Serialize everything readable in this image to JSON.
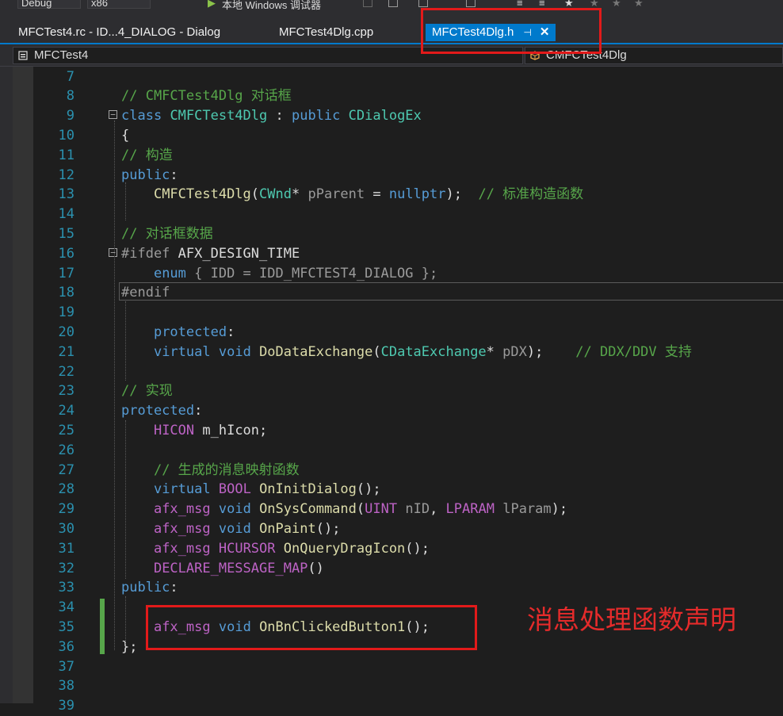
{
  "toolbar": {
    "config": "Debug",
    "platform": "x86",
    "run_label": "本地 Windows 调试器"
  },
  "tabs": [
    {
      "label": "MFCTest4.rc - ID...4_DIALOG - Dialog",
      "active": false
    },
    {
      "label": "MFCTest4Dlg.cpp",
      "active": false
    },
    {
      "label": "MFCTest4Dlg.h",
      "active": true
    }
  ],
  "navbar": {
    "project": "MFCTest4",
    "scope": "CMFCTest4Dlg"
  },
  "editor": {
    "line_numbers": [
      "7",
      "8",
      "9",
      "10",
      "11",
      "12",
      "13",
      "14",
      "15",
      "16",
      "17",
      "18",
      "19",
      "20",
      "21",
      "22",
      "23",
      "24",
      "25",
      "26",
      "27",
      "28",
      "29",
      "30",
      "31",
      "32",
      "33",
      "34",
      "35",
      "36",
      "37",
      "38",
      "39"
    ],
    "lines": [
      [],
      [
        {
          "t": "// CMFCTest4Dlg 对话框",
          "c": "cm"
        }
      ],
      [
        {
          "t": "class",
          "c": "kw"
        },
        {
          "t": " "
        },
        {
          "t": "CMFCTest4Dlg",
          "c": "ty"
        },
        {
          "t": " : "
        },
        {
          "t": "public",
          "c": "kw"
        },
        {
          "t": " "
        },
        {
          "t": "CDialogEx",
          "c": "ty"
        }
      ],
      [
        {
          "t": "{"
        }
      ],
      [
        {
          "t": "// 构造",
          "c": "cm"
        }
      ],
      [
        {
          "t": "public",
          "c": "kw"
        },
        {
          "t": ":"
        }
      ],
      [
        {
          "t": "    "
        },
        {
          "t": "CMFCTest4Dlg",
          "c": "fn"
        },
        {
          "t": "("
        },
        {
          "t": "CWnd",
          "c": "ty"
        },
        {
          "t": "* "
        },
        {
          "t": "pParent",
          "c": "prm"
        },
        {
          "t": " = "
        },
        {
          "t": "nullptr",
          "c": "kw"
        },
        {
          "t": ");  "
        },
        {
          "t": "// 标准构造函数",
          "c": "cm"
        }
      ],
      [],
      [
        {
          "t": "// 对话框数据",
          "c": "cm"
        }
      ],
      [
        {
          "t": "#ifdef",
          "c": "pp"
        },
        {
          "t": " AFX_DESIGN_TIME"
        }
      ],
      [
        {
          "t": "    "
        },
        {
          "t": "enum",
          "c": "kw"
        },
        {
          "t": " { IDD = IDD_MFCTEST4_DIALOG };",
          "c": "greybg"
        }
      ],
      [
        {
          "t": "#endif",
          "c": "pp"
        }
      ],
      [],
      [
        {
          "t": "    "
        },
        {
          "t": "protected",
          "c": "kw"
        },
        {
          "t": ":"
        }
      ],
      [
        {
          "t": "    "
        },
        {
          "t": "virtual",
          "c": "kw"
        },
        {
          "t": " "
        },
        {
          "t": "void",
          "c": "kw"
        },
        {
          "t": " "
        },
        {
          "t": "DoDataExchange",
          "c": "fn"
        },
        {
          "t": "("
        },
        {
          "t": "CDataExchange",
          "c": "ty"
        },
        {
          "t": "* "
        },
        {
          "t": "pDX",
          "c": "prm"
        },
        {
          "t": ");    "
        },
        {
          "t": "// DDX/DDV 支持",
          "c": "cm"
        }
      ],
      [],
      [
        {
          "t": "// 实现",
          "c": "cm"
        }
      ],
      [
        {
          "t": "protected",
          "c": "kw"
        },
        {
          "t": ":"
        }
      ],
      [
        {
          "t": "    "
        },
        {
          "t": "HICON",
          "c": "mac"
        },
        {
          "t": " m_hIcon;"
        }
      ],
      [],
      [
        {
          "t": "    "
        },
        {
          "t": "// 生成的消息映射函数",
          "c": "cm"
        }
      ],
      [
        {
          "t": "    "
        },
        {
          "t": "virtual",
          "c": "kw"
        },
        {
          "t": " "
        },
        {
          "t": "BOOL",
          "c": "mac"
        },
        {
          "t": " "
        },
        {
          "t": "OnInitDialog",
          "c": "fn"
        },
        {
          "t": "();"
        }
      ],
      [
        {
          "t": "    "
        },
        {
          "t": "afx_msg",
          "c": "mac"
        },
        {
          "t": " "
        },
        {
          "t": "void",
          "c": "kw"
        },
        {
          "t": " "
        },
        {
          "t": "OnSysCommand",
          "c": "fn"
        },
        {
          "t": "("
        },
        {
          "t": "UINT",
          "c": "mac"
        },
        {
          "t": " "
        },
        {
          "t": "nID",
          "c": "prm"
        },
        {
          "t": ", "
        },
        {
          "t": "LPARAM",
          "c": "mac"
        },
        {
          "t": " "
        },
        {
          "t": "lParam",
          "c": "prm"
        },
        {
          "t": ");"
        }
      ],
      [
        {
          "t": "    "
        },
        {
          "t": "afx_msg",
          "c": "mac"
        },
        {
          "t": " "
        },
        {
          "t": "void",
          "c": "kw"
        },
        {
          "t": " "
        },
        {
          "t": "OnPaint",
          "c": "fn"
        },
        {
          "t": "();"
        }
      ],
      [
        {
          "t": "    "
        },
        {
          "t": "afx_msg",
          "c": "mac"
        },
        {
          "t": " "
        },
        {
          "t": "HCURSOR",
          "c": "mac"
        },
        {
          "t": " "
        },
        {
          "t": "OnQueryDragIcon",
          "c": "fn"
        },
        {
          "t": "();"
        }
      ],
      [
        {
          "t": "    "
        },
        {
          "t": "DECLARE_MESSAGE_MAP",
          "c": "mac"
        },
        {
          "t": "()"
        }
      ],
      [
        {
          "t": "public",
          "c": "kw"
        },
        {
          "t": ":"
        }
      ],
      [],
      [
        {
          "t": "    "
        },
        {
          "t": "afx_msg",
          "c": "mac"
        },
        {
          "t": " "
        },
        {
          "t": "void",
          "c": "kw"
        },
        {
          "t": " "
        },
        {
          "t": "OnBnClickedButton1",
          "c": "fn"
        },
        {
          "t": "();"
        }
      ],
      [
        {
          "t": "};"
        }
      ],
      [],
      [],
      []
    ]
  },
  "annotation": {
    "text": "消息处理函数声明",
    "color": "#e52b2b"
  }
}
